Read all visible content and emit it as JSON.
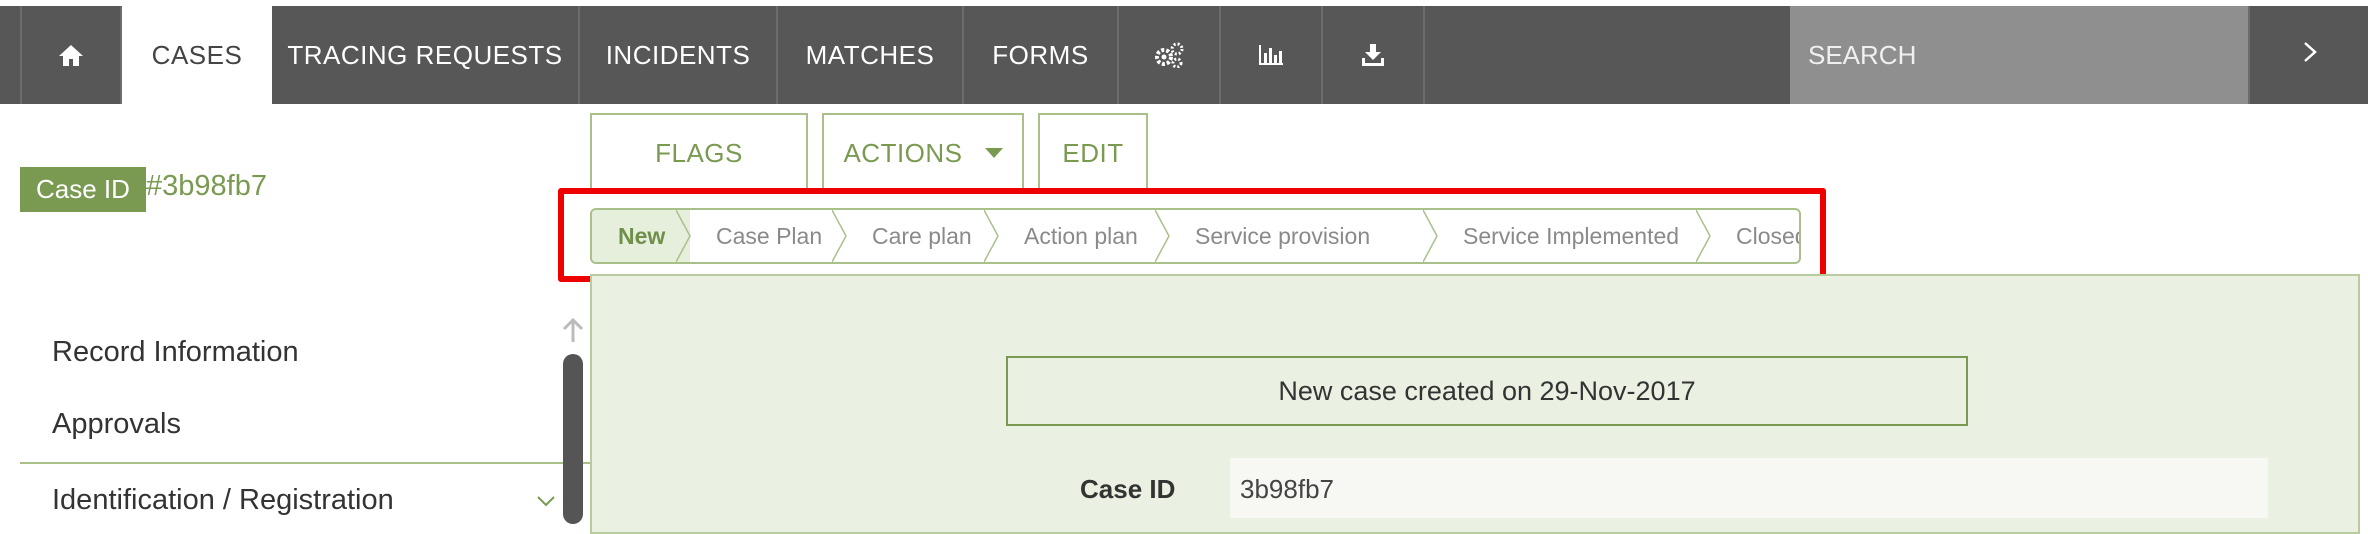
{
  "nav": {
    "tabs": [
      "CASES",
      "TRACING REQUESTS",
      "INCIDENTS",
      "MATCHES",
      "FORMS"
    ],
    "icons": [
      "home-icon",
      "settings-gears-icon",
      "bar-chart-icon",
      "download-icon"
    ],
    "search_placeholder": "SEARCH",
    "search_go_icon": "chevron-right-icon"
  },
  "case": {
    "id_label": "Case ID",
    "id_value": "#3b98fb7"
  },
  "actions": {
    "flags": "FLAGS",
    "actions": "ACTIONS",
    "edit": "EDIT"
  },
  "workflow": {
    "steps": [
      "New",
      "Case Plan",
      "Care plan",
      "Action plan",
      "Service provision",
      "Service Implemented",
      "Closed"
    ],
    "active_step": "New"
  },
  "sidebar": {
    "items": [
      "Record Information",
      "Approvals",
      "Identification / Registration"
    ]
  },
  "main": {
    "created_message": "New case created on 29-Nov-2017",
    "fields": [
      {
        "label": "Case ID",
        "value": "3b98fb7"
      }
    ]
  },
  "colors": {
    "accent": "#7a9a52",
    "nav_bg": "#575757",
    "highlight": "#ee0000"
  }
}
